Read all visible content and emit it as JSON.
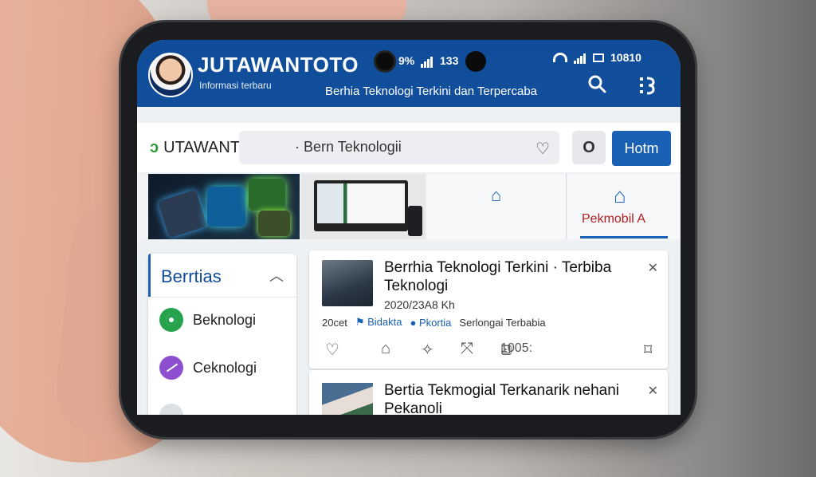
{
  "header": {
    "brand_title": "JUTAWANTOTO",
    "brand_subtitle": "Informasi terbaru",
    "tagline": "Berhia Teknologi Terkini dan Terpercaba",
    "status_left": "9%",
    "status_mid": "133",
    "status_right": "10810"
  },
  "nav": {
    "logo_text": "UTAWANTO",
    "search_text": "· Bern Teknologii",
    "hot_button": "Hotm"
  },
  "tabs": {
    "tab2_label": "Pekmobil A"
  },
  "sidebar": {
    "title": "Berrtias",
    "items": [
      {
        "label": "Beknologi"
      },
      {
        "label": "Ceknologi"
      },
      {
        "label": ""
      }
    ]
  },
  "feed": [
    {
      "title": "Berrhia Teknologi Terkini · Terbiba Teknologi",
      "date": "2020/23A8 Kh",
      "meta_left": "20cet",
      "meta_a": "Bidakta",
      "meta_b": "Pkortia",
      "meta_c": "Serlongai Terbabia",
      "count": "1005:"
    },
    {
      "title": "Bertia Tekmogial Terkanarik nehani Pekanoli",
      "date": "",
      "meta_left": "",
      "meta_a": "",
      "meta_b": "",
      "meta_c": "",
      "count": ""
    }
  ],
  "colors": {
    "brand_blue": "#0f4c9a",
    "accent_blue": "#1a61b6",
    "green": "#25a24b",
    "purple": "#8d4fd0",
    "alert_red": "#b01f1f"
  },
  "icons": [
    "search-icon",
    "menu-icon",
    "heart-icon",
    "circle-icon",
    "home-icon",
    "close-icon",
    "like-icon",
    "share-icon",
    "comment-icon",
    "bookmark-icon"
  ]
}
